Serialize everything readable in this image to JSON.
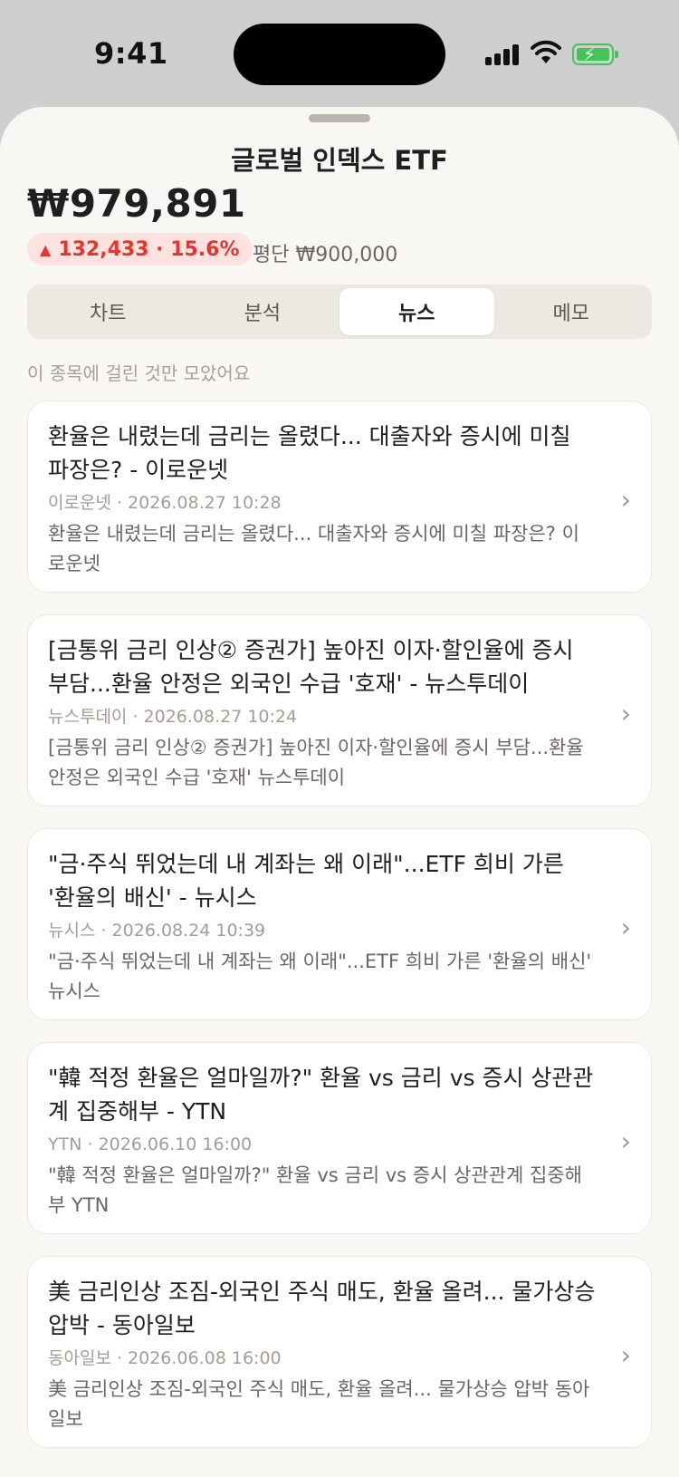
{
  "status_bar": {
    "time": "9:41"
  },
  "header": {
    "title": "글로벌 인덱스 ETF",
    "price": "₩979,891",
    "change": "132,433 · 15.6%",
    "avg_price": "평단 ₩900,000"
  },
  "colors": {
    "up": "#e5352d",
    "background": "#f9f7f3",
    "battery": "#43c558"
  },
  "tabs": [
    {
      "label": "차트",
      "active": false
    },
    {
      "label": "분석",
      "active": false
    },
    {
      "label": "뉴스",
      "active": true
    },
    {
      "label": "메모",
      "active": false
    }
  ],
  "hint": "이 종목에 걸린 것만 모았어요",
  "news": [
    {
      "title": "환율은 내렸는데 금리는 올렸다... 대출자와 증시에 미칠 파장은? - 이로운넷",
      "meta": "이로운넷 · 2026.08.27 10:28",
      "summary": "환율은 내렸는데 금리는 올렸다... 대출자와 증시에 미칠 파장은? 이로운넷"
    },
    {
      "title": "[금통위 금리 인상② 증권가] 높아진 이자·할인율에 증시 부담...환율 안정은 외국인 수급 '호재' - 뉴스투데이",
      "meta": "뉴스투데이 · 2026.08.27 10:24",
      "summary": "[금통위 금리 인상② 증권가] 높아진 이자·할인율에 증시 부담...환율 안정은 외국인 수급 '호재' 뉴스투데이"
    },
    {
      "title": "\"금·주식 뛰었는데 내 계좌는 왜 이래\"...ETF 희비 가른 '환율의 배신' - 뉴시스",
      "meta": "뉴시스 · 2026.08.24 10:39",
      "summary": "\"금·주식 뛰었는데 내 계좌는 왜 이래\"...ETF 희비 가른 '환율의 배신' 뉴시스"
    },
    {
      "title": "\"韓 적정 환율은 얼마일까?\" 환율 vs 금리 vs 증시 상관관계 집중해부 - YTN",
      "meta": "YTN · 2026.06.10 16:00",
      "summary": "\"韓 적정 환율은 얼마일까?\" 환율 vs 금리 vs 증시 상관관계 집중해부 YTN"
    },
    {
      "title": "美 금리인상 조짐-외국인 주식 매도, 환율 올려... 물가상승 압박 - 동아일보",
      "meta": "동아일보 · 2026.06.08 16:00",
      "summary": "美 금리인상 조짐-외국인 주식 매도, 환율 올려... 물가상승 압박 동아일보"
    }
  ]
}
